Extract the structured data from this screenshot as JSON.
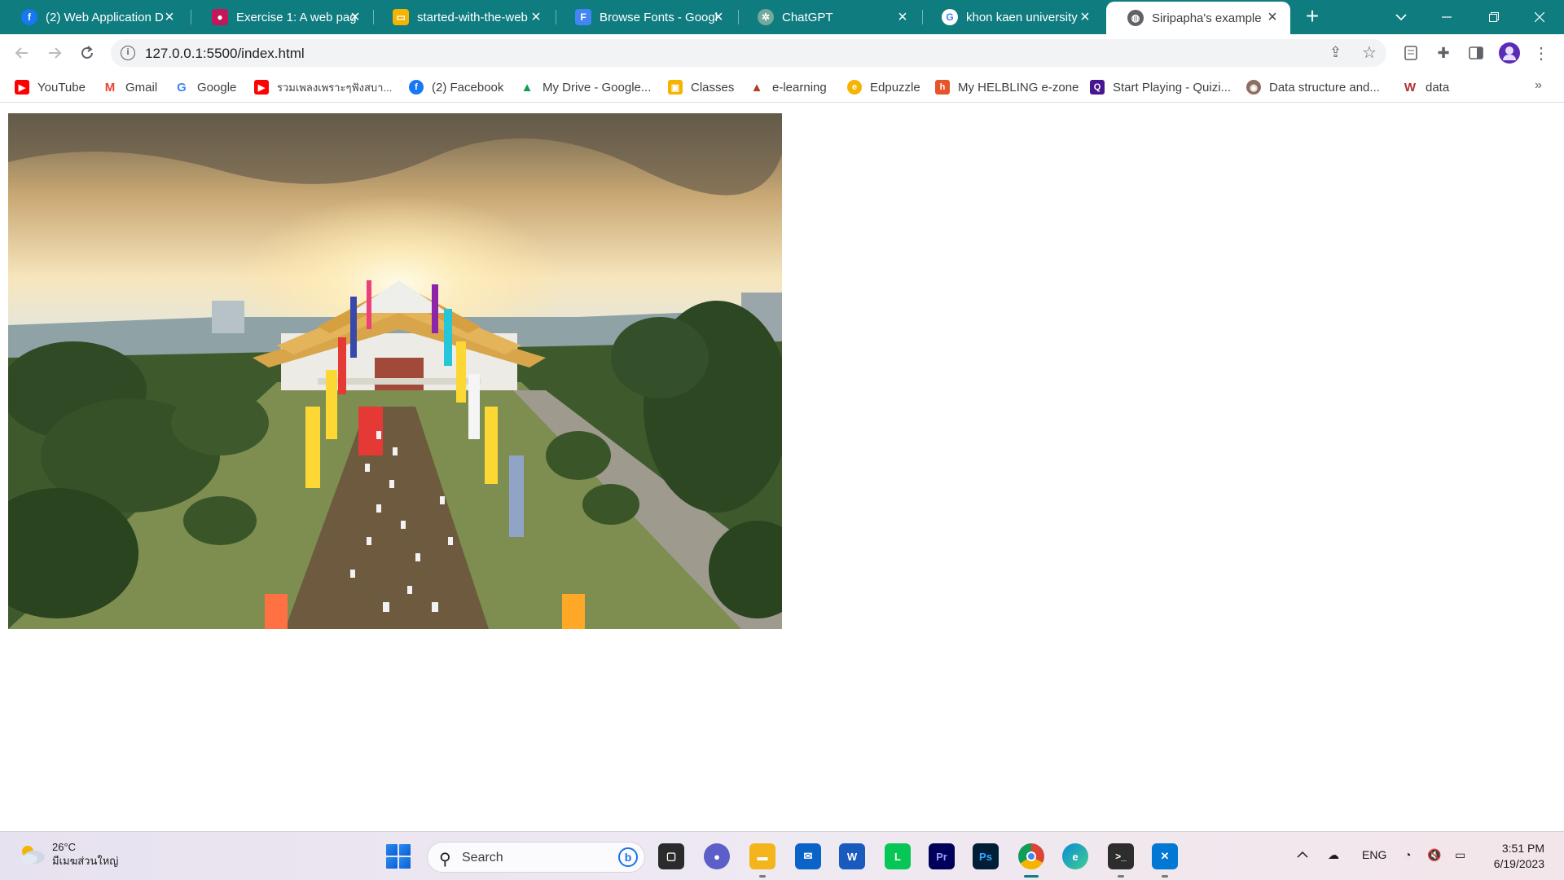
{
  "browser": {
    "tabs": [
      {
        "title": "(2) Web Application D",
        "favicon": "facebook-icon",
        "color": "#1877f2",
        "active": false
      },
      {
        "title": "Exercise 1: A web pag",
        "favicon": "classroom-icon",
        "color": "#c2185b",
        "active": false
      },
      {
        "title": "started-with-the-web",
        "favicon": "slides-icon",
        "color": "#f4b400",
        "active": false
      },
      {
        "title": "Browse Fonts - Googl",
        "favicon": "google-fonts-icon",
        "color": "#4285f4",
        "active": false
      },
      {
        "title": "ChatGPT",
        "favicon": "chatgpt-icon",
        "color": "#74aa9c",
        "active": false
      },
      {
        "title": "khon kaen university",
        "favicon": "google-icon",
        "color": "#ffffff",
        "active": false
      },
      {
        "title": "Siripapha's example",
        "favicon": "globe-icon",
        "color": "#5f6368",
        "active": true
      }
    ],
    "url": "127.0.0.1:5500/index.html",
    "accent_color": "#0f7c80"
  },
  "bookmarks": [
    {
      "label": "YouTube",
      "icon": "youtube-icon",
      "color": "#ff0000"
    },
    {
      "label": "Gmail",
      "icon": "gmail-icon",
      "color": "#ea4335"
    },
    {
      "label": "Google",
      "icon": "google-icon",
      "color": "#4285f4"
    },
    {
      "label": "รวมเพลงเพราะๆฟังสบา...",
      "icon": "youtube-icon",
      "color": "#ff0000"
    },
    {
      "label": "(2) Facebook",
      "icon": "facebook-icon",
      "color": "#1877f2"
    },
    {
      "label": "My Drive - Google...",
      "icon": "drive-icon",
      "color": "#0f9d58"
    },
    {
      "label": "Classes",
      "icon": "classroom-icon",
      "color": "#f4b400"
    },
    {
      "label": "e-learning",
      "icon": "elearning-icon",
      "color": "#b04020"
    },
    {
      "label": "Edpuzzle",
      "icon": "edpuzzle-icon",
      "color": "#f4b400"
    },
    {
      "label": "My HELBLING e-zone",
      "icon": "helbling-icon",
      "color": "#e8542a"
    },
    {
      "label": "Start Playing - Quizi...",
      "icon": "quizizz-icon",
      "color": "#46178f"
    },
    {
      "label": "Data structure and...",
      "icon": "kku-icon",
      "color": "#8d6e63"
    },
    {
      "label": "data",
      "icon": "wikipedia-icon",
      "color": "#b03030"
    }
  ],
  "page": {
    "image_label": "aerial-photo-university-hall"
  },
  "taskbar": {
    "weather_temp": "26°C",
    "weather_text": "มีเมฆส่วนใหญ่",
    "search_label": "Search",
    "apps": [
      {
        "name": "task-view-icon",
        "color": "#2b2b2b",
        "glyph": "▢"
      },
      {
        "name": "meet-icon",
        "color": "#5b5fc7",
        "glyph": "●"
      },
      {
        "name": "file-explorer-icon",
        "color": "#f3b51b",
        "glyph": "▬"
      },
      {
        "name": "mail-icon",
        "color": "#0a64c8",
        "glyph": "✉"
      },
      {
        "name": "word-icon",
        "color": "#185abd",
        "glyph": "W"
      },
      {
        "name": "line-icon",
        "color": "#06c755",
        "glyph": "L"
      },
      {
        "name": "premiere-icon",
        "color": "#00005b",
        "glyph": "Pr"
      },
      {
        "name": "photoshop-icon",
        "color": "#001e36",
        "glyph": "Ps"
      },
      {
        "name": "chrome-icon",
        "color": "#db4437",
        "glyph": "●"
      },
      {
        "name": "edge-icon",
        "color": "#0c8ad8",
        "glyph": "e"
      },
      {
        "name": "terminal-icon",
        "color": "#2d2d2d",
        "glyph": ">_"
      },
      {
        "name": "vscode-icon",
        "color": "#0078d4",
        "glyph": "✕"
      }
    ],
    "language": "ENG",
    "time": "3:51 PM",
    "date": "6/19/2023"
  }
}
